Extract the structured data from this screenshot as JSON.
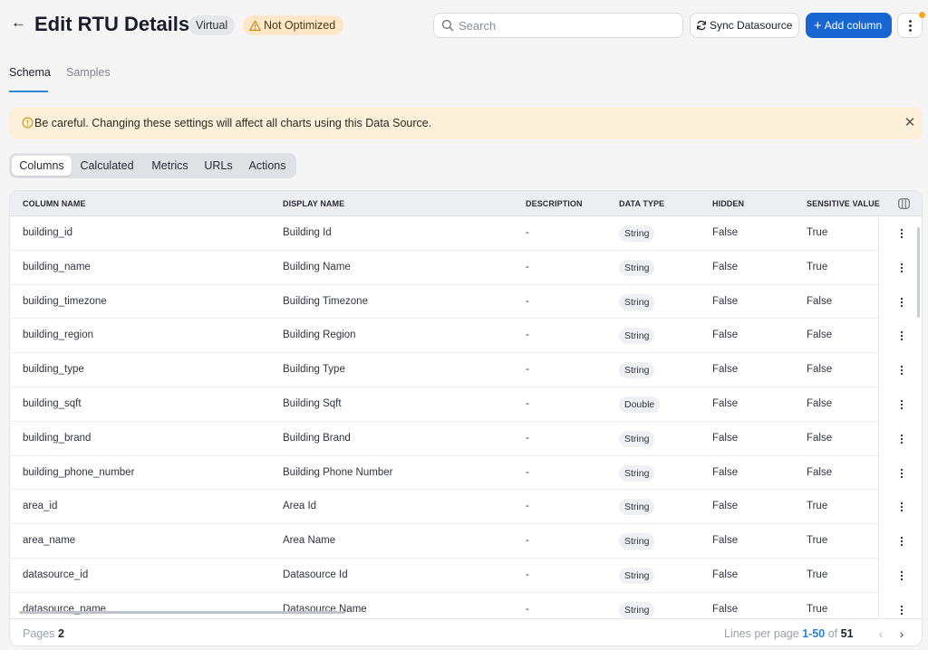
{
  "header": {
    "back_icon": "arrow-left-icon",
    "title": "Edit RTU Details",
    "badge_virtual": "Virtual",
    "badge_warning": "Not Optimized",
    "search_placeholder": "Search",
    "sync_label": "Sync Datasource",
    "add_label": "Add column",
    "colors": {
      "primary": "#1966d2",
      "warning_bg": "#fde7c7",
      "notify_dot": "#f5a623"
    }
  },
  "tabs": [
    "Schema",
    "Samples"
  ],
  "alert": {
    "message": "Be careful. Changing these settings will affect all charts using this Data Source.",
    "close": "✕"
  },
  "segments": [
    "Columns",
    "Calculated",
    "Metrics",
    "URLs",
    "Actions"
  ],
  "table": {
    "headers": [
      "COLUMN NAME",
      "DISPLAY NAME",
      "DESCRIPTION",
      "DATA TYPE",
      "HIDDEN",
      "SENSITIVE VALUE"
    ],
    "rows": [
      {
        "column": "building_id",
        "display": "Building Id",
        "description": "-",
        "type": "String",
        "hidden": "False",
        "sensitive": "True"
      },
      {
        "column": "building_name",
        "display": "Building Name",
        "description": "-",
        "type": "String",
        "hidden": "False",
        "sensitive": "True"
      },
      {
        "column": "building_timezone",
        "display": "Building Timezone",
        "description": "-",
        "type": "String",
        "hidden": "False",
        "sensitive": "False"
      },
      {
        "column": "building_region",
        "display": "Building Region",
        "description": "-",
        "type": "String",
        "hidden": "False",
        "sensitive": "False"
      },
      {
        "column": "building_type",
        "display": "Building Type",
        "description": "-",
        "type": "String",
        "hidden": "False",
        "sensitive": "False"
      },
      {
        "column": "building_sqft",
        "display": "Building Sqft",
        "description": "-",
        "type": "Double",
        "hidden": "False",
        "sensitive": "False"
      },
      {
        "column": "building_brand",
        "display": "Building Brand",
        "description": "-",
        "type": "String",
        "hidden": "False",
        "sensitive": "False"
      },
      {
        "column": "building_phone_number",
        "display": "Building Phone Number",
        "description": "-",
        "type": "String",
        "hidden": "False",
        "sensitive": "False"
      },
      {
        "column": "area_id",
        "display": "Area Id",
        "description": "-",
        "type": "String",
        "hidden": "False",
        "sensitive": "True"
      },
      {
        "column": "area_name",
        "display": "Area Name",
        "description": "-",
        "type": "String",
        "hidden": "False",
        "sensitive": "True"
      },
      {
        "column": "datasource_id",
        "display": "Datasource Id",
        "description": "-",
        "type": "String",
        "hidden": "False",
        "sensitive": "True"
      },
      {
        "column": "datasource_name",
        "display": "Datasource Name",
        "description": "-",
        "type": "String",
        "hidden": "False",
        "sensitive": "True"
      }
    ]
  },
  "footer": {
    "pages_label": "Pages",
    "pages_value": "2",
    "lines_label": "Lines per page",
    "lines_range": "1-50",
    "of_label": "of",
    "total": "51"
  }
}
